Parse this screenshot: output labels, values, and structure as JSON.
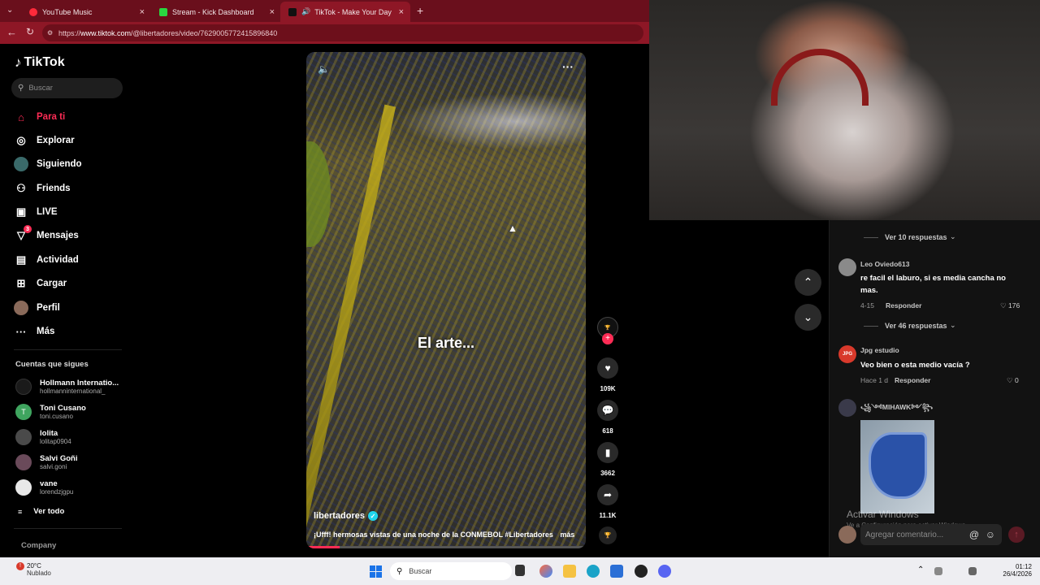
{
  "browser": {
    "tabs": [
      {
        "title": "YouTube Music",
        "color": "#ff2a3a"
      },
      {
        "title": "Stream - Kick Dashboard",
        "color": "#2ad640"
      },
      {
        "title": "TikTok - Make Your Day",
        "color": "#111111"
      }
    ],
    "url_prefix": "https://",
    "url_host": "www.tiktok.com",
    "url_path": "/@libertadores/video/7629005772415896840"
  },
  "sidebar": {
    "logo": "TikTok",
    "search_placeholder": "Buscar",
    "items": [
      {
        "label": "Para ti",
        "icon": "home-icon"
      },
      {
        "label": "Explorar",
        "icon": "compass-icon"
      },
      {
        "label": "Siguiendo",
        "icon": "following-icon"
      },
      {
        "label": "Friends",
        "icon": "friends-icon"
      },
      {
        "label": "LIVE",
        "icon": "live-icon"
      },
      {
        "label": "Mensajes",
        "icon": "messages-icon",
        "badge": "3"
      },
      {
        "label": "Actividad",
        "icon": "activity-icon"
      },
      {
        "label": "Cargar",
        "icon": "upload-icon"
      },
      {
        "label": "Perfil",
        "icon": "profile-icon"
      },
      {
        "label": "Más",
        "icon": "more-icon"
      }
    ],
    "following_header": "Cuentas que sigues",
    "following": [
      {
        "name": "Hollmann Internatio...",
        "handle": "hollmanninternational_"
      },
      {
        "name": "Toni Cusano",
        "handle": "toni.cusano",
        "initial": "T"
      },
      {
        "name": "lolita",
        "handle": "lolitap0904"
      },
      {
        "name": "Salvi Goñi",
        "handle": "salvi.goni"
      },
      {
        "name": "vane",
        "handle": "lorendzjgpu"
      }
    ],
    "see_all": "Ver todo",
    "company": "Company"
  },
  "video": {
    "overlay_text": "El arte...",
    "author": "libertadores",
    "caption": "¡Ufff! hermosas vistas de una noche de la CONMEBOL #Libertadores",
    "more": "más"
  },
  "actions": {
    "likes": "109K",
    "comments": "618",
    "saves": "3662",
    "shares": "11.1K"
  },
  "comments": {
    "items": [
      {
        "type": "replies",
        "label": "Ver 10 respuestas"
      },
      {
        "name": "Leo Oviedo613",
        "text": "re facil el laburo, si es media cancha no mas.",
        "date": "4-15",
        "reply": "Responder",
        "likes": "176"
      },
      {
        "type": "replies",
        "label": "Ver 46 respuestas"
      },
      {
        "name": "Jpg estudio",
        "text": "Veo bien o esta medio vacía ?",
        "date": "Hace 1 d",
        "reply": "Responder",
        "likes": "0"
      },
      {
        "name": "꧁༺MIHAWK༻꧂",
        "text": ""
      }
    ],
    "input_placeholder": "Agregar comentario...",
    "watermark_title": "Activar Windows",
    "watermark_sub": "Ve a Configuración para activar Windows."
  },
  "taskbar": {
    "temp": "20°C",
    "weather": "Nublado",
    "search": "Buscar",
    "time": "01:12",
    "date": "26/4/2026"
  }
}
